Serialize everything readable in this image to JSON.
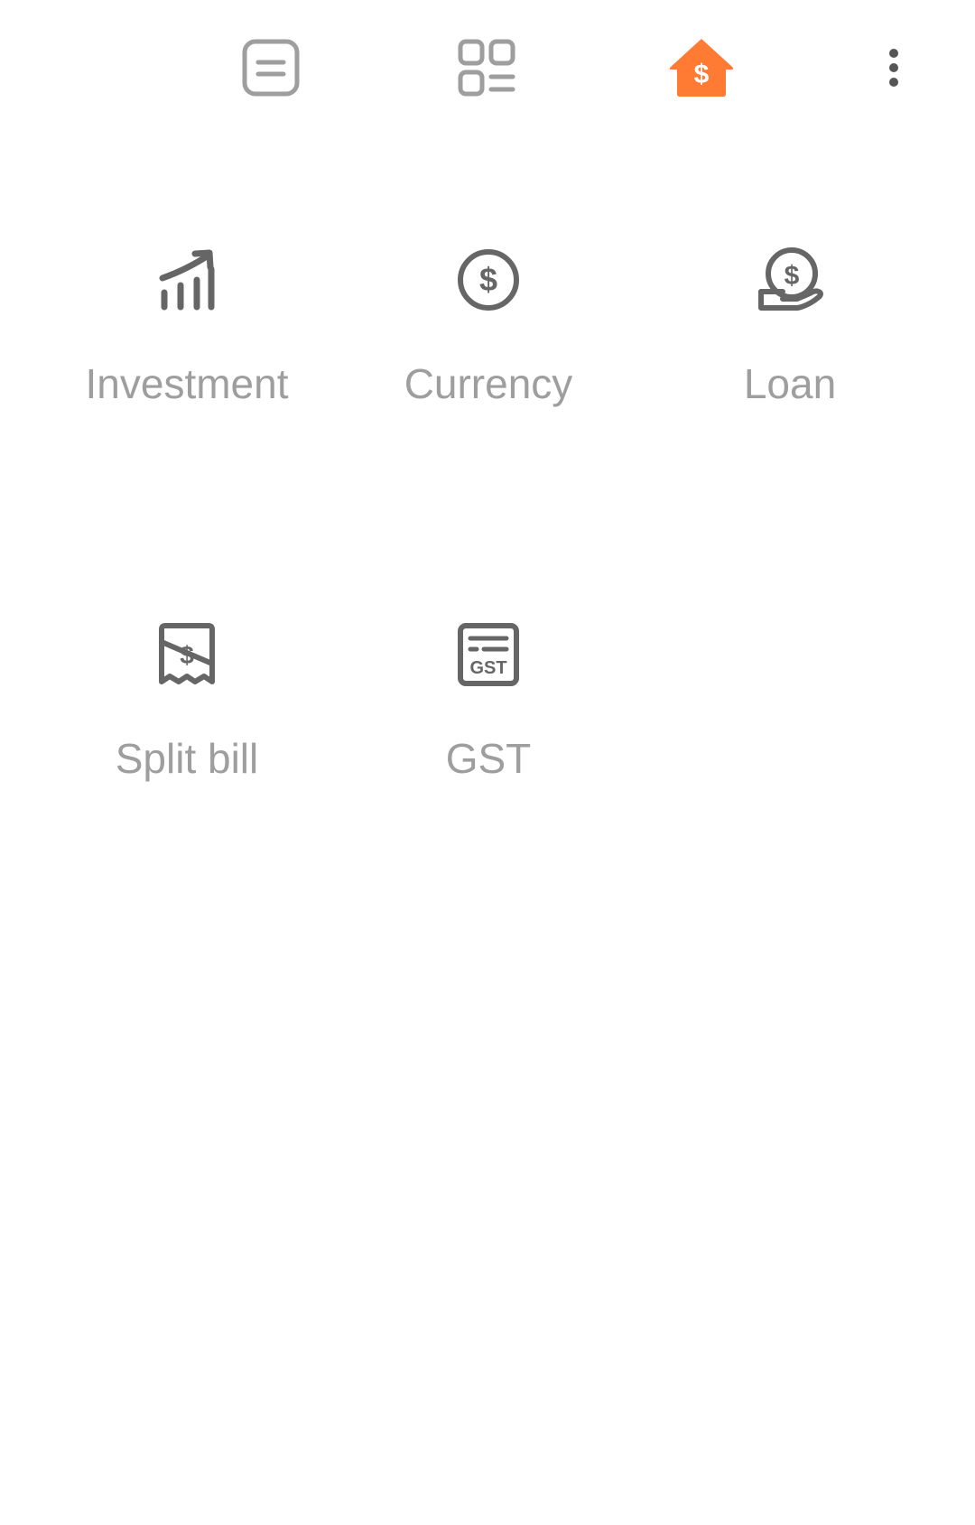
{
  "topbar": {
    "tabs": [
      {
        "icon": "notes-icon",
        "active": false
      },
      {
        "icon": "categories-icon",
        "active": false
      },
      {
        "icon": "finance-home-icon",
        "active": true
      }
    ],
    "more_icon": "more-vert-icon"
  },
  "tools": [
    {
      "label": "Investment",
      "icon": "investment-chart-icon"
    },
    {
      "label": "Currency",
      "icon": "dollar-coin-icon"
    },
    {
      "label": "Loan",
      "icon": "hand-coin-icon"
    },
    {
      "label": "Split bill",
      "icon": "split-bill-icon"
    },
    {
      "label": "GST",
      "icon": "gst-receipt-icon"
    }
  ],
  "colors": {
    "accent": "#ff7a33",
    "icon": "#666666",
    "tab_inactive": "#9e9e9e",
    "label": "#9e9e9e"
  }
}
